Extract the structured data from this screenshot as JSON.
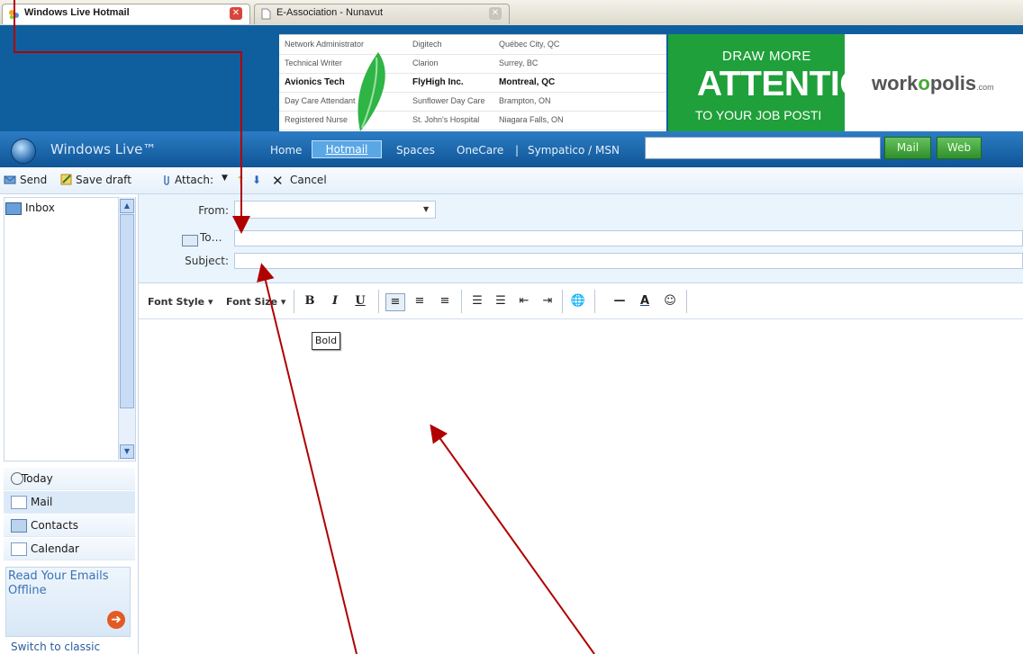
{
  "browser": {
    "tabs": [
      {
        "title": "Windows Live Hotmail",
        "active": true
      },
      {
        "title": "E-Association - Nunavut",
        "active": false
      }
    ]
  },
  "banner": {
    "jobs": [
      {
        "title": "Network Administrator",
        "company": "Digitech",
        "location": "Québec City, QC",
        "bold": false
      },
      {
        "title": "Technical Writer",
        "company": "Clarion",
        "location": "Surrey, BC",
        "bold": false
      },
      {
        "title": "Avionics Tech",
        "company": "FlyHigh Inc.",
        "location": "Montreal, QC",
        "bold": true
      },
      {
        "title": "Day Care Attendant",
        "company": "Sunflower Day Care",
        "location": "Brampton, ON",
        "bold": false
      },
      {
        "title": "Registered Nurse",
        "company": "St. John's Hospital",
        "location": "Niagara Falls, ON",
        "bold": false
      }
    ],
    "ad_line1": "DRAW MORE",
    "ad_line2": "ATTENTIO",
    "ad_line3": "TO YOUR JOB POSTI",
    "logo_pre": "work",
    "logo_mid": "o",
    "logo_post": "polis",
    "logo_suffix": ".com"
  },
  "nav": {
    "brand": "Windows Live™",
    "links": [
      "Home",
      "Hotmail",
      "Spaces",
      "OneCare",
      "|",
      "Sympatico / MSN"
    ],
    "search_value": "",
    "mail_button": "Mail",
    "web_button": "Web"
  },
  "toolbar": {
    "send": "Send",
    "save_draft": "Save draft",
    "attach": "Attach:",
    "cancel": "Cancel"
  },
  "sidebar": {
    "inbox": "Inbox",
    "nav_items": [
      "Today",
      "Mail",
      "Contacts",
      "Calendar"
    ],
    "promo": "Read Your Emails\nOffline",
    "switch": "Switch to classic"
  },
  "compose": {
    "from_label": "From:",
    "from_value": "",
    "to_label": "To…",
    "to_value": "",
    "subject_label": "Subject:",
    "subject_value": "",
    "font_style": "Font Style ▾",
    "font_size": "Font Size ▾",
    "tooltip": "Bold"
  },
  "colors": {
    "annotation_arrow": "#b00000",
    "nav_blue": "#1a68ad",
    "ad_green": "#1fa03a"
  }
}
